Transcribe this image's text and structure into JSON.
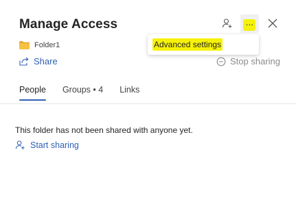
{
  "dialog": {
    "title": "Manage Access",
    "folder_name": "Folder1",
    "share_label": "Share",
    "stop_sharing_label": "Stop sharing",
    "more_label": "...",
    "icons": {
      "person": "person-add-icon",
      "more": "more-icon",
      "close": "close-icon",
      "folder": "folder-icon",
      "share": "share-icon",
      "stop": "stop-sharing-icon",
      "start": "start-sharing-icon"
    }
  },
  "menu": {
    "items": [
      {
        "label": "Advanced settings",
        "highlighted": true
      }
    ]
  },
  "tabs": [
    {
      "label": "People",
      "active": true
    },
    {
      "label": "Groups • 4",
      "active": false
    },
    {
      "label": "Links",
      "active": false
    }
  ],
  "content": {
    "empty_message": "This folder has not been shared with anyone yet.",
    "start_sharing_label": "Start sharing"
  },
  "colors": {
    "accent": "#2f5fb3",
    "highlight": "#f6f20a",
    "folder": "#f5c242"
  }
}
